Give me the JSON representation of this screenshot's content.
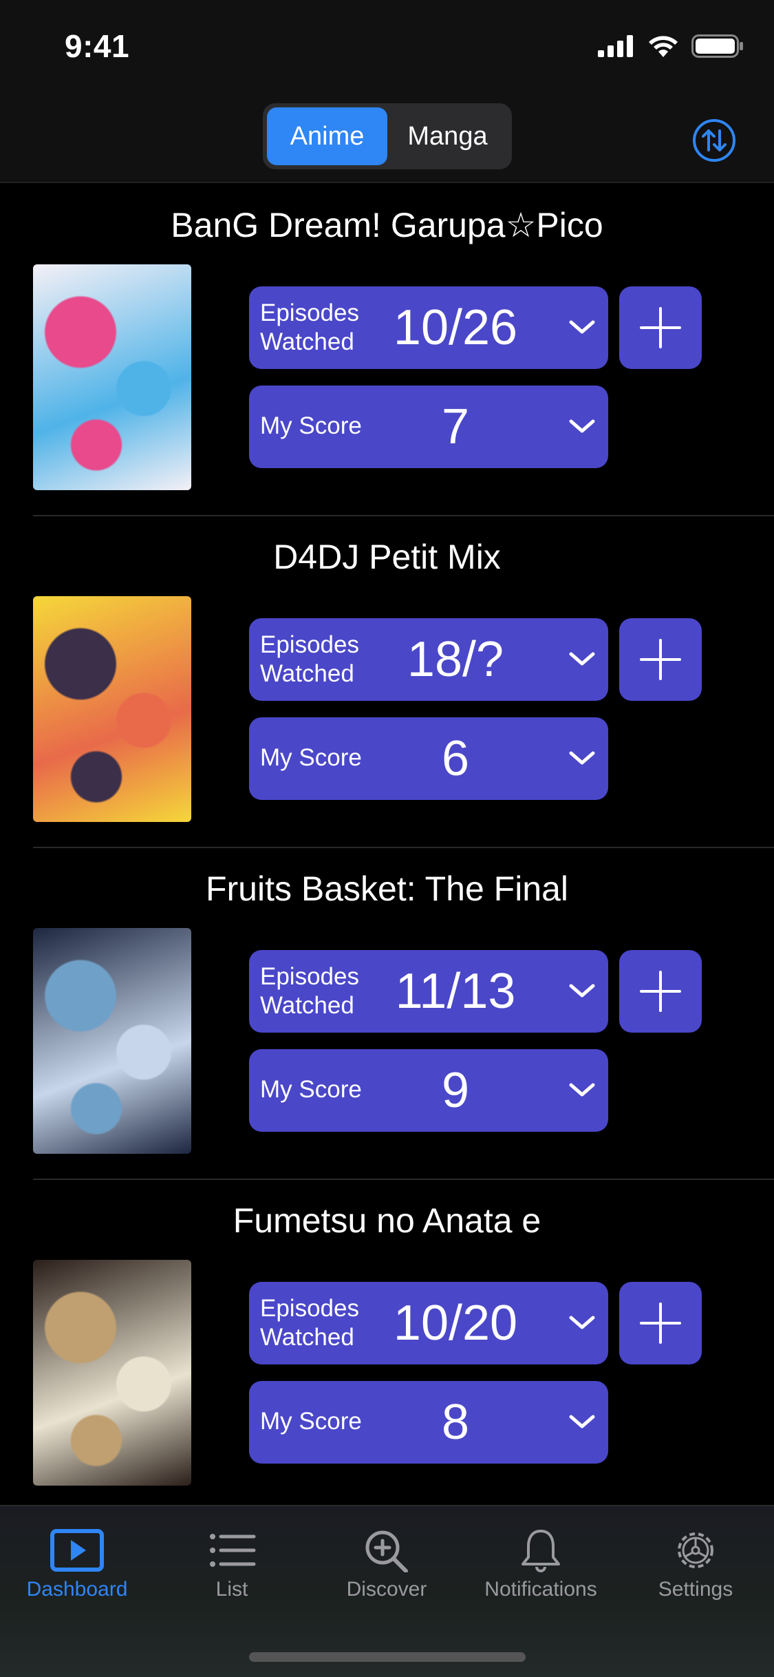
{
  "status_bar": {
    "time": "9:41"
  },
  "header": {
    "segments": [
      {
        "label": "Anime",
        "active": true
      },
      {
        "label": "Manga",
        "active": false
      }
    ]
  },
  "entries": [
    {
      "title": "BanG Dream! Garupa☆Pico",
      "episodes_label_1": "Episodes",
      "episodes_label_2": "Watched",
      "episodes": "10/26",
      "score_label": "My Score",
      "score": "7",
      "cover_colors": [
        "#f4f0f6",
        "#e84a8c",
        "#4fb3e8"
      ]
    },
    {
      "title": "D4DJ Petit Mix",
      "episodes_label_1": "Episodes",
      "episodes_label_2": "Watched",
      "episodes": "18/?",
      "score_label": "My Score",
      "score": "6",
      "cover_colors": [
        "#f5d73a",
        "#3b2f4a",
        "#e86a4a"
      ]
    },
    {
      "title": "Fruits Basket: The Final",
      "episodes_label_1": "Episodes",
      "episodes_label_2": "Watched",
      "episodes": "11/13",
      "score_label": "My Score",
      "score": "9",
      "cover_colors": [
        "#1d2740",
        "#6fa0c8",
        "#c7d6ea"
      ]
    },
    {
      "title": "Fumetsu no Anata e",
      "episodes_label_1": "Episodes",
      "episodes_label_2": "Watched",
      "episodes": "10/20",
      "score_label": "My Score",
      "score": "8",
      "cover_colors": [
        "#2a1f1a",
        "#c0a070",
        "#e9e2cf"
      ]
    }
  ],
  "tabs": [
    {
      "label": "Dashboard",
      "icon": "play-icon",
      "active": true
    },
    {
      "label": "List",
      "icon": "list-icon",
      "active": false
    },
    {
      "label": "Discover",
      "icon": "magnifier-plus-icon",
      "active": false
    },
    {
      "label": "Notifications",
      "icon": "bell-icon",
      "active": false
    },
    {
      "label": "Settings",
      "icon": "gear-icon",
      "active": false
    }
  ],
  "colors": {
    "accent": "#2f86f5",
    "control": "#4a47c9",
    "background": "#000000"
  }
}
